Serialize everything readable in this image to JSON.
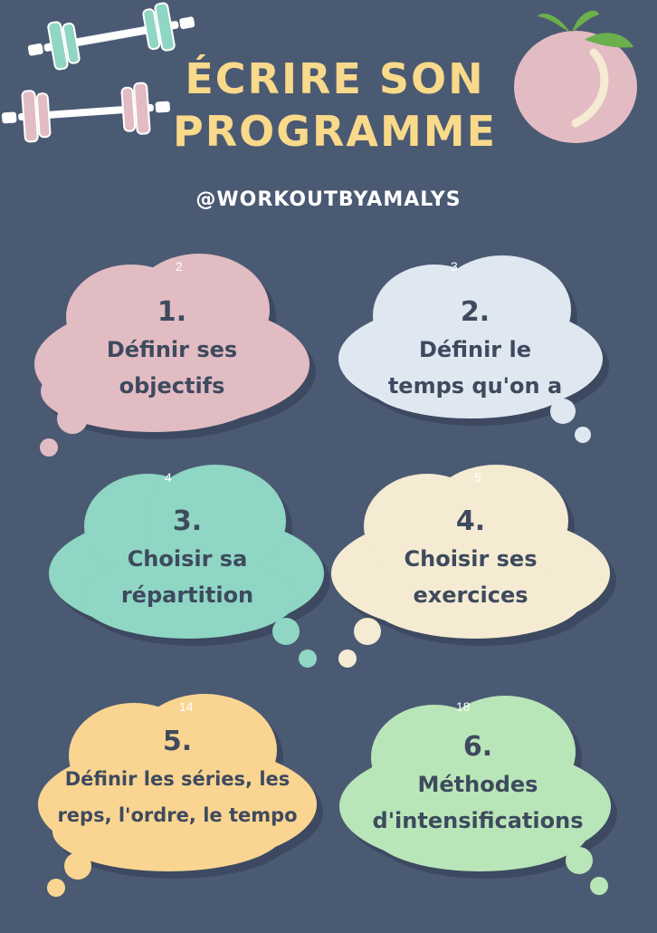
{
  "title": {
    "line1": "écrire son",
    "line2": "programme"
  },
  "handle": "@workoutbyamalys",
  "colors": {
    "background": "#4b5a73",
    "title": "#f9d98a",
    "text": "#3e4a5e"
  },
  "steps": [
    {
      "page": "2",
      "number": "1.",
      "line1": "Définir ses",
      "line2": "objectifs",
      "color": "#e2bcc3"
    },
    {
      "page": "3",
      "number": "2.",
      "line1": "Définir le",
      "line2": "temps qu'on a",
      "color": "#dfe8f0"
    },
    {
      "page": "4",
      "number": "3.",
      "line1": "Choisir sa",
      "line2": "répartition",
      "color": "#8fd6c4"
    },
    {
      "page": "5",
      "number": "4.",
      "line1": "Choisir ses",
      "line2": "exercices",
      "color": "#f4ebd2"
    },
    {
      "page": "14",
      "number": "5.",
      "line1": "Définir les séries, les",
      "line2": "reps, l'ordre, le tempo",
      "color": "#fad592"
    },
    {
      "page": "18",
      "number": "6.",
      "line1": "Méthodes",
      "line2": "d'intensifications",
      "color": "#b9e6b8"
    }
  ],
  "decorations": {
    "dumbbell_top": "dumbbell-icon",
    "dumbbell_bottom": "dumbbell-icon",
    "peach": "peach-icon"
  }
}
